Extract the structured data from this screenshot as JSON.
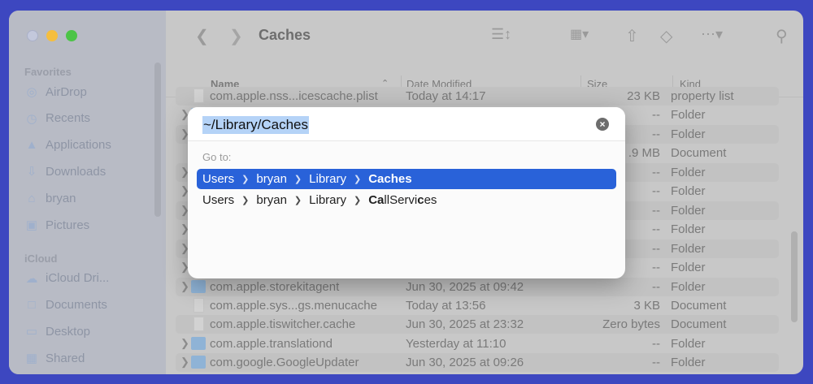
{
  "window": {
    "title": "Caches"
  },
  "sidebar": {
    "sections": [
      {
        "title": "Favorites",
        "items": [
          {
            "label": "AirDrop",
            "icon": "airdrop-icon"
          },
          {
            "label": "Recents",
            "icon": "clock-icon"
          },
          {
            "label": "Applications",
            "icon": "applications-icon"
          },
          {
            "label": "Downloads",
            "icon": "download-icon"
          },
          {
            "label": "bryan",
            "icon": "home-icon"
          },
          {
            "label": "Pictures",
            "icon": "pictures-icon"
          }
        ]
      },
      {
        "title": "iCloud",
        "items": [
          {
            "label": "iCloud Dri...",
            "icon": "cloud-icon"
          },
          {
            "label": "Documents",
            "icon": "document-icon"
          },
          {
            "label": "Desktop",
            "icon": "desktop-icon"
          },
          {
            "label": "Shared",
            "icon": "shared-folder-icon"
          }
        ]
      }
    ]
  },
  "columns": {
    "name": "Name",
    "date": "Date Modified",
    "size": "Size",
    "kind": "Kind"
  },
  "rows": [
    {
      "name": "com.apple.nss...icescache.plist",
      "date": "Today at 14:17",
      "size": "23 KB",
      "kind": "property list",
      "type": "doc"
    },
    {
      "name": "",
      "date": "",
      "size": "--",
      "kind": "Folder",
      "type": "folder"
    },
    {
      "name": "",
      "date": "",
      "size": "--",
      "kind": "Folder",
      "type": "folder"
    },
    {
      "name": "",
      "date": "",
      "size": ".9 MB",
      "kind": "Document",
      "type": "doc"
    },
    {
      "name": "",
      "date": "",
      "size": "--",
      "kind": "Folder",
      "type": "folder"
    },
    {
      "name": "",
      "date": "",
      "size": "--",
      "kind": "Folder",
      "type": "folder"
    },
    {
      "name": "",
      "date": "",
      "size": "--",
      "kind": "Folder",
      "type": "folder"
    },
    {
      "name": "",
      "date": "",
      "size": "--",
      "kind": "Folder",
      "type": "folder"
    },
    {
      "name": "",
      "date": "",
      "size": "--",
      "kind": "Folder",
      "type": "folder"
    },
    {
      "name": "",
      "date": "",
      "size": "--",
      "kind": "Folder",
      "type": "folder"
    },
    {
      "name": "com.apple.storekitagent",
      "date": "Jun 30, 2025 at 09:42",
      "size": "--",
      "kind": "Folder",
      "type": "folder"
    },
    {
      "name": "com.apple.sys...gs.menucache",
      "date": "Today at 13:56",
      "size": "3 KB",
      "kind": "Document",
      "type": "doc"
    },
    {
      "name": "com.apple.tiswitcher.cache",
      "date": "Jun 30, 2025 at 23:32",
      "size": "Zero bytes",
      "kind": "Document",
      "type": "doc"
    },
    {
      "name": "com.apple.translationd",
      "date": "Yesterday at 11:10",
      "size": "--",
      "kind": "Folder",
      "type": "folder"
    },
    {
      "name": "com.google.GoogleUpdater",
      "date": "Jun 30, 2025 at 09:26",
      "size": "--",
      "kind": "Folder",
      "type": "folder"
    }
  ],
  "dialog": {
    "input_value": "~/Library/Caches",
    "goto_label": "Go to:",
    "suggestions": [
      {
        "parts": [
          "Users",
          "bryan",
          "Library"
        ],
        "last_bold": "Caches",
        "last_rest": ""
      },
      {
        "parts": [
          "Users",
          "bryan",
          "Library"
        ],
        "last_bold": "Ca",
        "last_mid": "llServi",
        "last_bold2": "c",
        "last_rest": "es"
      }
    ]
  },
  "colors": {
    "accent": "#2962d9",
    "background": "#3d47c0"
  }
}
